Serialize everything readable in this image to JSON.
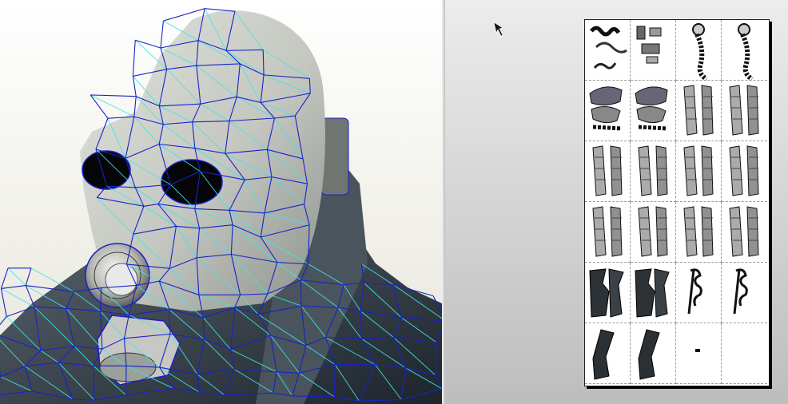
{
  "app": {
    "views": [
      "3d-model-view",
      "2d-unfold-view"
    ]
  },
  "model_view": {
    "subject": "gas-mask-head-mesh",
    "colors": {
      "wire_dark": "#1a22c8",
      "wire_light": "#3ee6e6",
      "mask": "#c9cbc3",
      "suit": "#39424a",
      "background": "#f2f1ea"
    }
  },
  "unfold_view": {
    "colors": {
      "background": "#c8c8c8",
      "sheet": "#ffffff",
      "sheet_shadow": "#000000",
      "page_border": "#9b9b9b"
    },
    "sheet": {
      "rows": 6,
      "columns": 4,
      "pages": [
        {
          "id": "p1",
          "icon": "head-parts-icon"
        },
        {
          "id": "p2",
          "icon": "small-parts-icon"
        },
        {
          "id": "p3",
          "icon": "hose-parts-icon"
        },
        {
          "id": "p4",
          "icon": "hose-parts-icon"
        },
        {
          "id": "p5",
          "icon": "mask-parts-icon"
        },
        {
          "id": "p6",
          "icon": "mask-parts-icon"
        },
        {
          "id": "p7",
          "icon": "strip-parts-icon"
        },
        {
          "id": "p8",
          "icon": "strip-parts-icon"
        },
        {
          "id": "p9",
          "icon": "strip-parts-icon"
        },
        {
          "id": "p10",
          "icon": "strip-parts-icon"
        },
        {
          "id": "p11",
          "icon": "strip-parts-icon"
        },
        {
          "id": "p12",
          "icon": "strip-parts-icon"
        },
        {
          "id": "p13",
          "icon": "strip-parts-icon"
        },
        {
          "id": "p14",
          "icon": "strip-parts-icon"
        },
        {
          "id": "p15",
          "icon": "strip-parts-icon"
        },
        {
          "id": "p16",
          "icon": "strip-parts-icon"
        },
        {
          "id": "p17",
          "icon": "body-parts-icon"
        },
        {
          "id": "p18",
          "icon": "body-parts-icon"
        },
        {
          "id": "p19",
          "icon": "tab-parts-icon"
        },
        {
          "id": "p20",
          "icon": "tab-parts-icon"
        },
        {
          "id": "p21",
          "icon": "arm-parts-icon"
        },
        {
          "id": "p22",
          "icon": "arm-parts-icon"
        },
        {
          "id": "p23",
          "icon": "dot-part-icon"
        },
        {
          "id": "p24",
          "icon": "empty-page"
        }
      ]
    }
  }
}
